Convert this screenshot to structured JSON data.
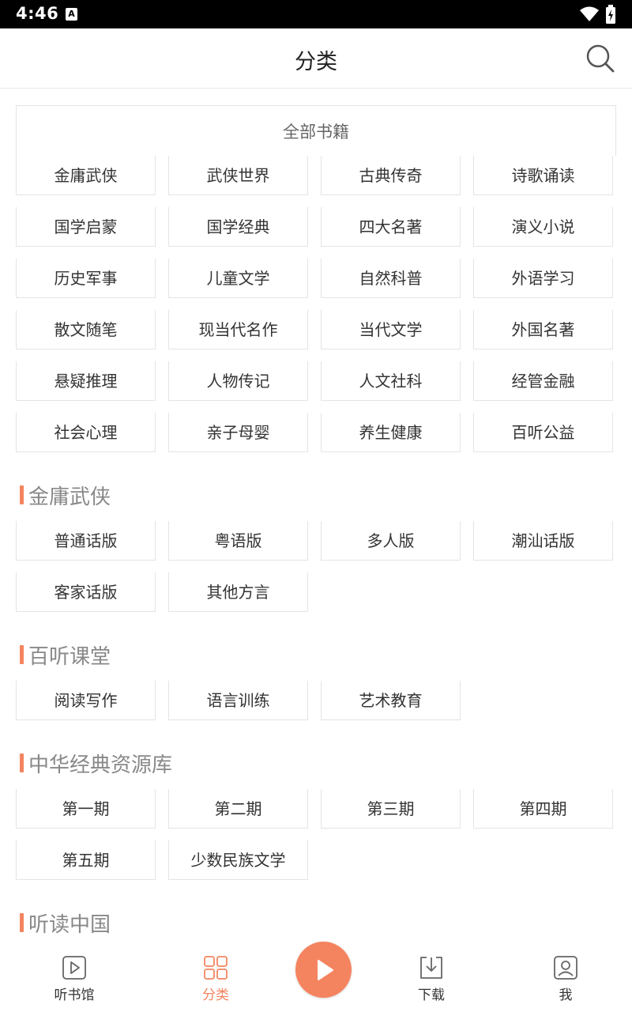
{
  "status_bar": {
    "time": "4:46",
    "notification_icon": "A"
  },
  "header": {
    "title": "分类",
    "search_icon": "search-icon"
  },
  "all_books": "全部书籍",
  "categories": [
    "金庸武侠",
    "武侠世界",
    "古典传奇",
    "诗歌诵读",
    "国学启蒙",
    "国学经典",
    "四大名著",
    "演义小说",
    "历史军事",
    "儿童文学",
    "自然科普",
    "外语学习",
    "散文随笔",
    "现当代名作",
    "当代文学",
    "外国名著",
    "悬疑推理",
    "人物传记",
    "人文社科",
    "经管金融",
    "社会心理",
    "亲子母婴",
    "养生健康",
    "百听公益"
  ],
  "sections": [
    {
      "title": "金庸武侠",
      "items": [
        "普通话版",
        "粤语版",
        "多人版",
        "潮汕话版",
        "客家话版",
        "其他方言"
      ]
    },
    {
      "title": "百听课堂",
      "items": [
        "阅读写作",
        "语言训练",
        "艺术教育"
      ]
    },
    {
      "title": "中华经典资源库",
      "items": [
        "第一期",
        "第二期",
        "第三期",
        "第四期",
        "第五期",
        "少数民族文学"
      ]
    },
    {
      "title": "听读中国",
      "items": []
    }
  ],
  "bottom_nav": {
    "items": [
      {
        "label": "听书馆",
        "icon": "play-square-icon",
        "active": false
      },
      {
        "label": "分类",
        "icon": "grid-icon",
        "active": true
      },
      {
        "label": "下载",
        "icon": "download-icon",
        "active": false
      },
      {
        "label": "我",
        "icon": "user-icon",
        "active": false
      }
    ],
    "play_icon": "play-icon"
  },
  "colors": {
    "accent": "#f4845f",
    "border": "#e4e4e4",
    "section_title": "#888888"
  }
}
